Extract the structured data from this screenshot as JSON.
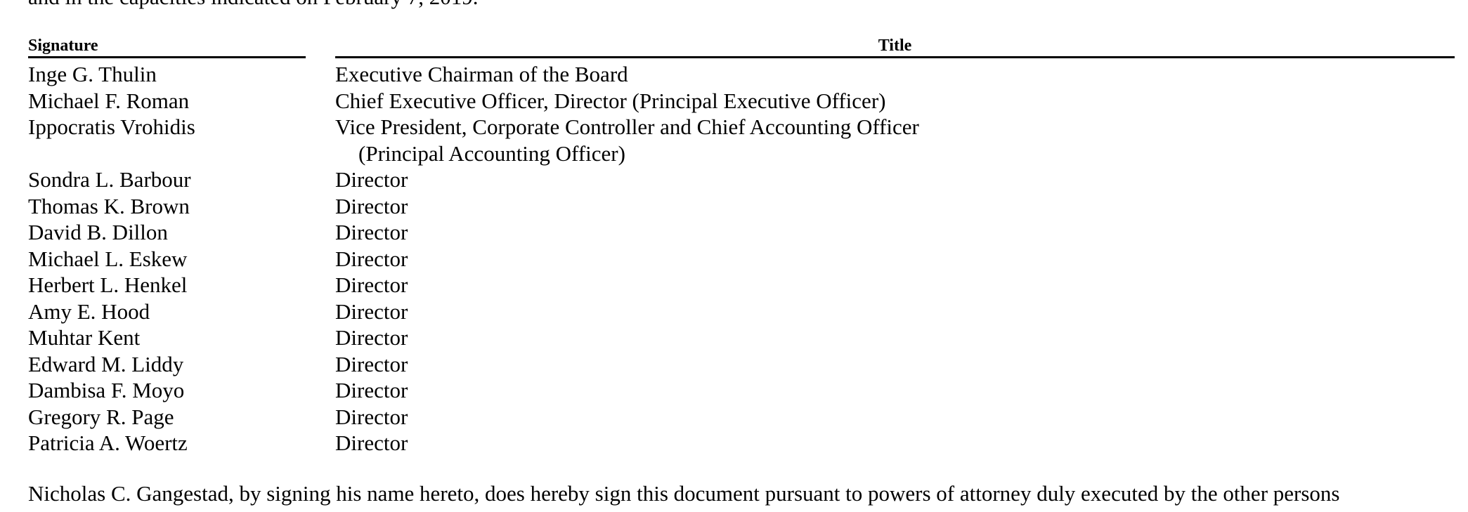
{
  "intro_text": "and in the capacities indicated on February 7, 2019.",
  "table": {
    "header_signature": "Signature",
    "header_title": "Title",
    "rows": [
      {
        "name": "Inge G. Thulin",
        "title": "Executive Chairman of the Board",
        "title_cont": ""
      },
      {
        "name": "Michael F. Roman",
        "title": "Chief Executive Officer, Director (Principal Executive Officer)",
        "title_cont": ""
      },
      {
        "name": "Ippocratis Vrohidis",
        "title": "Vice President, Corporate Controller and Chief Accounting Officer",
        "title_cont": "(Principal Accounting Officer)"
      },
      {
        "name": "Sondra L. Barbour",
        "title": "Director",
        "title_cont": ""
      },
      {
        "name": "Thomas K. Brown",
        "title": "Director",
        "title_cont": ""
      },
      {
        "name": "David B. Dillon",
        "title": "Director",
        "title_cont": ""
      },
      {
        "name": "Michael L. Eskew",
        "title": "Director",
        "title_cont": ""
      },
      {
        "name": "Herbert L. Henkel",
        "title": "Director",
        "title_cont": ""
      },
      {
        "name": "Amy E. Hood",
        "title": "Director",
        "title_cont": ""
      },
      {
        "name": "Muhtar Kent",
        "title": "Director",
        "title_cont": ""
      },
      {
        "name": "Edward M. Liddy",
        "title": "Director",
        "title_cont": ""
      },
      {
        "name": "Dambisa F. Moyo",
        "title": "Director",
        "title_cont": ""
      },
      {
        "name": "Gregory R. Page",
        "title": "Director",
        "title_cont": ""
      },
      {
        "name": "Patricia A. Woertz",
        "title": "Director",
        "title_cont": ""
      }
    ]
  },
  "footer_text": "Nicholas C. Gangestad, by signing his name hereto, does hereby sign this document pursuant to powers of attorney duly executed by the other persons"
}
